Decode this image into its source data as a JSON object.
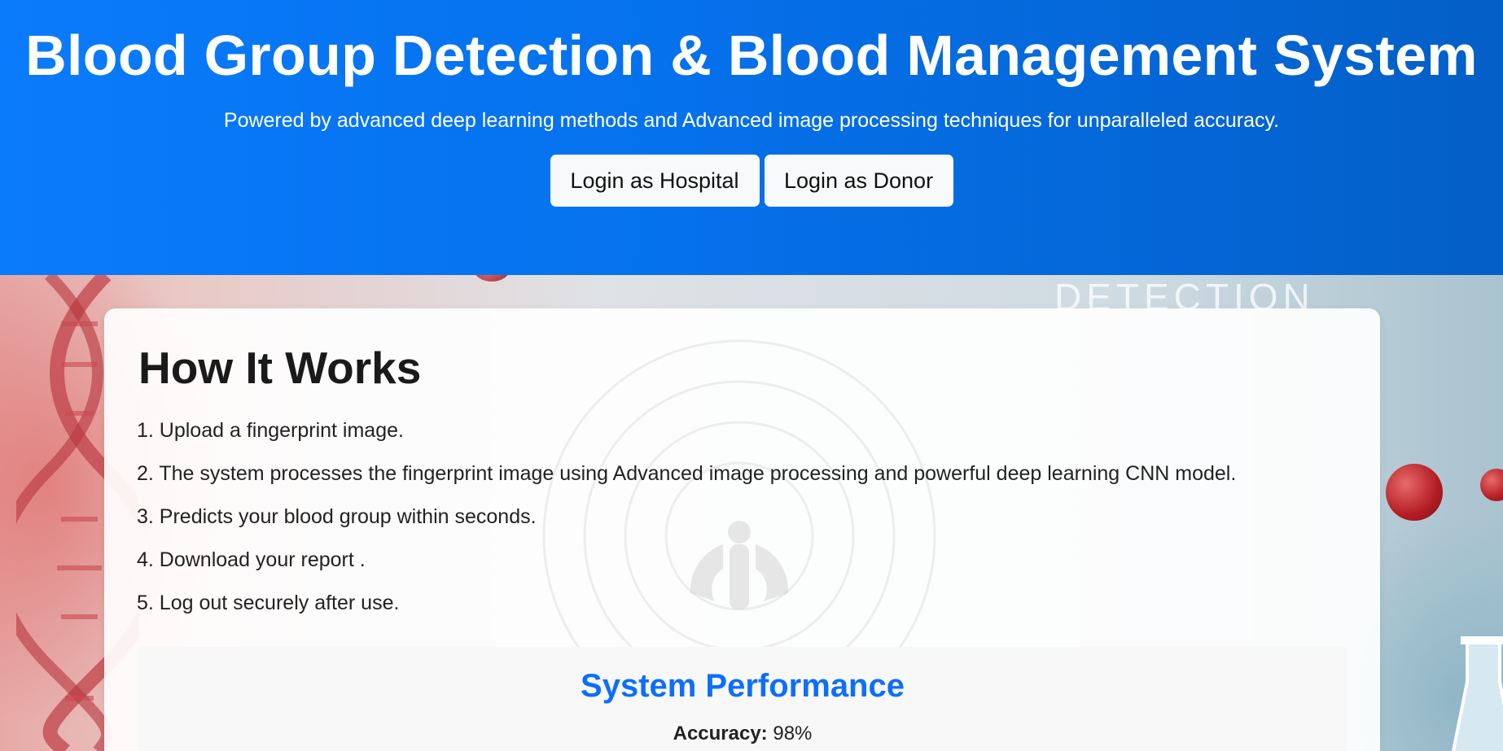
{
  "header": {
    "title": "Blood Group Detection & Blood Management System",
    "subtitle": "Powered by advanced deep learning methods and Advanced image processing techniques for unparalleled accuracy.",
    "buttons": {
      "hospital_label": "Login as Hospital",
      "donor_label": "Login as Donor"
    }
  },
  "background": {
    "text": "DETECTION"
  },
  "how_it_works": {
    "title": "How It Works",
    "steps": [
      "1. Upload a fingerprint image.",
      "2. The system processes the fingerprint image using Advanced image processing and powerful deep learning CNN model.",
      "3. Predicts your blood group within seconds.",
      "4. Download your report .",
      "5. Log out securely after use."
    ]
  },
  "performance": {
    "title": "System Performance",
    "accuracy_label": "Accuracy:",
    "accuracy_value": "98%"
  },
  "colors": {
    "header_gradient_start": "#0a7bfb",
    "header_gradient_end": "#045fc7",
    "accent_blue": "#0d6efd",
    "button_bg": "#f8f9fa"
  }
}
